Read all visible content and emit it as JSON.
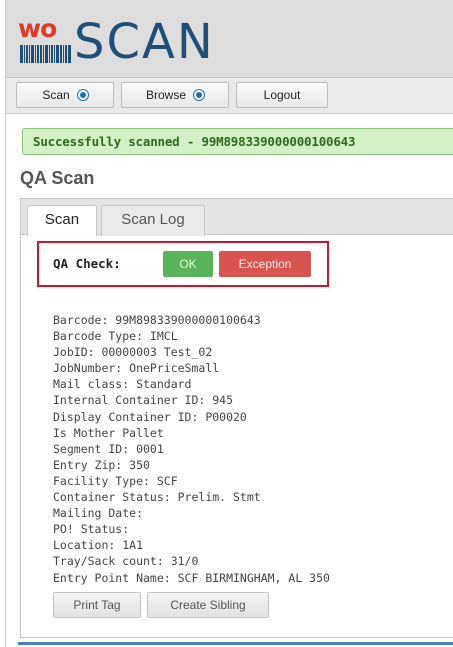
{
  "app": {
    "logo_prefix": "wo",
    "logo_main": "SCAN",
    "colors": {
      "logo_red": "#e03a25",
      "logo_blue": "#1e4f78",
      "accent_blue": "#1e6fb8",
      "ok_green": "#58b45a",
      "exception_red": "#d9534f",
      "highlight_red": "#d4142a",
      "success_bg": "#d4f0c7"
    }
  },
  "nav": {
    "items": [
      {
        "label": "Scan",
        "icon": "dropdown-dot-icon"
      },
      {
        "label": "Browse",
        "icon": "dropdown-dot-icon"
      },
      {
        "label": "Logout"
      }
    ]
  },
  "alert": {
    "message": "Successfully scanned - 99M898339000000100643"
  },
  "page": {
    "title": "QA Scan"
  },
  "tabs": [
    {
      "label": "Scan",
      "active": true
    },
    {
      "label": "Scan Log",
      "active": false
    }
  ],
  "qa": {
    "label": "QA Check:",
    "ok_label": "OK",
    "exception_label": "Exception"
  },
  "details": [
    "Barcode: 99M898339000000100643",
    "Barcode Type: IMCL",
    "JobID: 00000003 Test_02",
    "JobNumber: OnePriceSmall",
    "Mail class: Standard",
    "Internal Container ID: 945",
    "Display Container ID: P00020",
    "Is Mother Pallet",
    "Segment ID: 0001",
    "Entry Zip: 350",
    "Facility Type: SCF",
    "Container Status: Prelim. Stmt",
    "Mailing Date:",
    "PO! Status:",
    "Location: 1A1",
    "Tray/Sack count: 31/0",
    "Entry Point Name: SCF BIRMINGHAM, AL 350"
  ],
  "actions": {
    "print_tag": "Print Tag",
    "create_sibling": "Create Sibling"
  }
}
